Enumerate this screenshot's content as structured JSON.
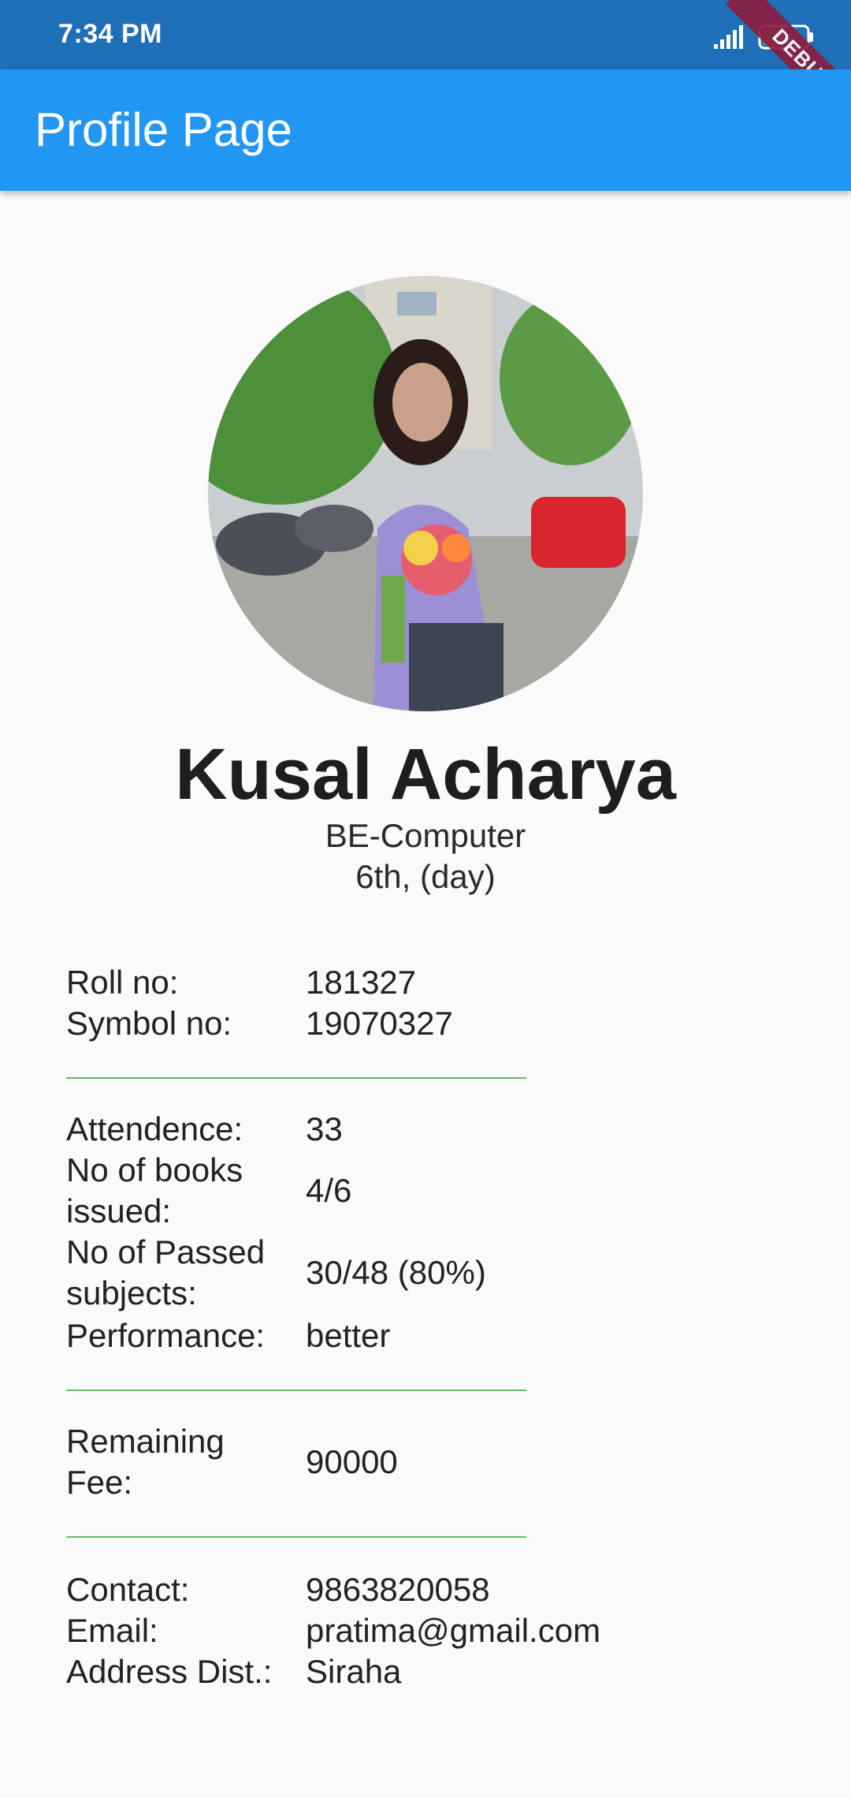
{
  "status_bar": {
    "time": "7:34 PM",
    "battery": "26",
    "debug_label": "DEBUG"
  },
  "app_bar": {
    "title": "Profile Page"
  },
  "profile": {
    "name": "Kusal Acharya",
    "department": "BE-Computer",
    "semester": "6th,  (day)"
  },
  "ids": {
    "roll_label": "Roll no:",
    "roll_value": "181327",
    "symbol_label": "Symbol no:",
    "symbol_value": "19070327"
  },
  "academics": {
    "attendance_label": "Attendence:",
    "attendance_value": "33",
    "books_label_1": "No of books",
    "books_label_2": "issued:",
    "books_value": "4/6",
    "passed_label_1": "No of Passed",
    "passed_label_2": "subjects:",
    "passed_value": "30/48 (80%)",
    "performance_label": "Performance:",
    "performance_value": "better"
  },
  "fees": {
    "remaining_label_1": "Remaining",
    "remaining_label_2": "Fee:",
    "remaining_value": "90000"
  },
  "contact": {
    "contact_label": "Contact:",
    "contact_value": "9863820058",
    "email_label": "Email:",
    "email_value": "pratima@gmail.com",
    "address_label": "Address Dist.:",
    "address_value": "Siraha"
  },
  "colors": {
    "status_bar": "#1f6fb8",
    "app_bar": "#2196f3",
    "divider": "#66bb6a",
    "debug_banner": "#8b1e3f"
  }
}
